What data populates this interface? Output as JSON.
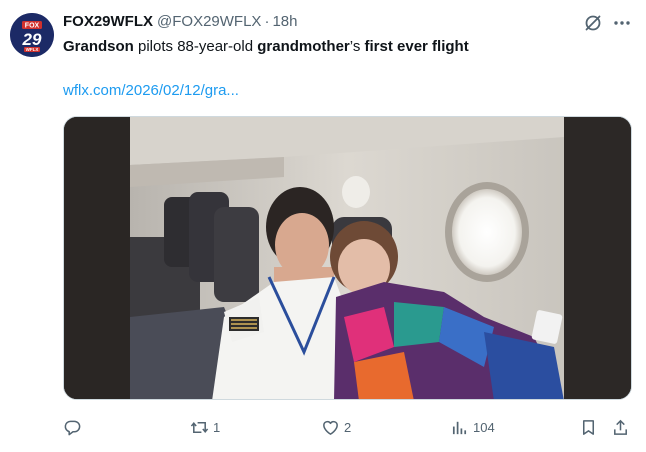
{
  "author": {
    "name": "FOX29WFLX",
    "handle": "@FOX29WFLX",
    "separator": "·",
    "time": "18h",
    "avatar_top": "FOX",
    "avatar_num": "29",
    "avatar_bottom": "WFLX"
  },
  "tweet": {
    "w1": "Grandson",
    "w2": " pilots 88-year-old ",
    "w3": "grandmother",
    "w4": "’s ",
    "w5": "first ever flight",
    "link": "wflx.com/2026/02/12/gra..."
  },
  "actions": {
    "reposts": "1",
    "likes": "2",
    "views": "104"
  },
  "colors": {
    "link": "#1d9bf0",
    "muted": "#536471",
    "avatar_bg": "#1c2a66",
    "avatar_badge": "#d0312d"
  },
  "icons": [
    "grok-icon",
    "more-icon",
    "reply-icon",
    "repost-icon",
    "like-icon",
    "views-icon",
    "bookmark-icon",
    "share-icon"
  ]
}
